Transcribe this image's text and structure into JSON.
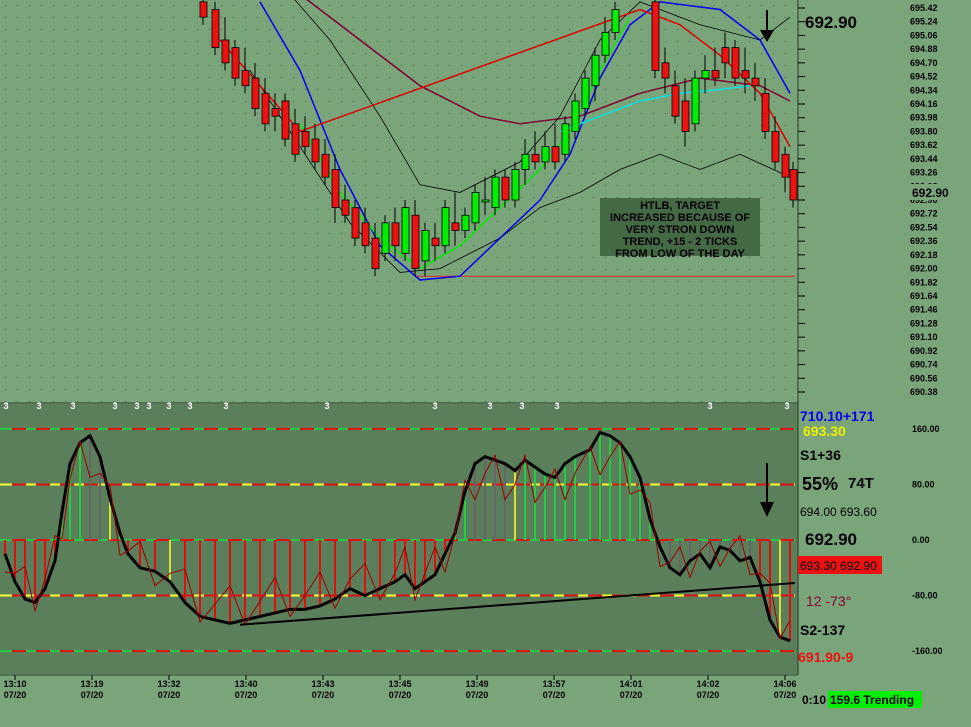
{
  "chart_data": [
    {
      "type": "candlestick",
      "panel": "price",
      "last_price_label": "692.90",
      "right_axis_price_label": "692.90",
      "y_ticks": [
        "695.42",
        "695.24",
        "695.06",
        "694.88",
        "694.70",
        "694.52",
        "694.34",
        "694.16",
        "693.98",
        "693.80",
        "693.62",
        "693.44",
        "693.26",
        "693.08",
        "692.90",
        "692.72",
        "692.54",
        "692.36",
        "692.18",
        "692.00",
        "691.82",
        "691.64",
        "691.46",
        "691.28",
        "691.10",
        "690.92",
        "690.74",
        "690.56",
        "690.38"
      ],
      "ylim": [
        690.38,
        695.5
      ],
      "annotation_lines": [
        "HTLB, TARGET",
        "INCREASED BECAUSE OF",
        "VERY STRON DOWN",
        "TREND, +15 - 2 TICKS",
        "FROM LOW OF THE DAY"
      ],
      "low_of_day_line": 691.9,
      "colors": {
        "up": "#00ee00",
        "down": "#ee1111",
        "ma_blue": "#0000ee",
        "ma_maroon": "#800030",
        "ma_cyan": "#00e0e0",
        "ma_red": "#dd0000",
        "ma_green": "#00ee00",
        "band": "#000000"
      }
    },
    {
      "type": "histogram",
      "panel": "cci",
      "y_ticks": [
        "160.00",
        "80.00",
        "0.00",
        "-80.00",
        "-160.00"
      ],
      "ylim": [
        -180,
        180
      ],
      "level_lines": [
        160,
        80,
        0,
        -80,
        -160
      ],
      "colors": {
        "up": "#22cc44",
        "down": "#dd1111",
        "neutral": "#666666",
        "signal": "#dddd33",
        "line": "#000000",
        "thin_line": "#990000"
      }
    }
  ],
  "info_panel": {
    "pivot": "710.10+171",
    "pivot_price": "693.30",
    "s1": "S1+36",
    "percent": "55%",
    "ticks": "74T",
    "bid_ask": "694.00 693.60",
    "price": "692.90",
    "range": "693.30 692.90",
    "angle": "12  -73°",
    "s2": "S2-137",
    "low": "691.90-9"
  },
  "markers": {
    "three": "3"
  },
  "x_axis": [
    {
      "time": "13:10",
      "date": "07/20"
    },
    {
      "time": "13:19",
      "date": "07/20"
    },
    {
      "time": "13:32",
      "date": "07/20"
    },
    {
      "time": "13:40",
      "date": "07/20"
    },
    {
      "time": "13:43",
      "date": "07/20"
    },
    {
      "time": "13:45",
      "date": "07/20"
    },
    {
      "time": "13:49",
      "date": "07/20"
    },
    {
      "time": "13:57",
      "date": "07/20"
    },
    {
      "time": "14:01",
      "date": "07/20"
    },
    {
      "time": "14:02",
      "date": "07/20"
    },
    {
      "time": "14:06",
      "date": "07/20"
    }
  ],
  "status": {
    "timer": "0:10",
    "trend_label": "159.6 Trending",
    "trend_color": "#00ee00"
  }
}
